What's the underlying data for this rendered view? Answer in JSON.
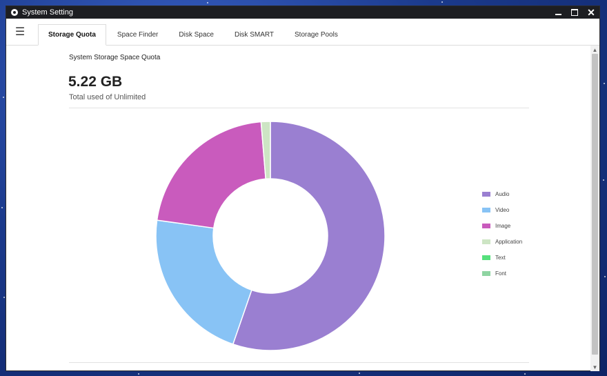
{
  "window": {
    "title": "System Setting"
  },
  "tabs": [
    {
      "label": "Storage Quota",
      "active": true
    },
    {
      "label": "Space Finder",
      "active": false
    },
    {
      "label": "Disk Space",
      "active": false
    },
    {
      "label": "Disk SMART",
      "active": false
    },
    {
      "label": "Storage Pools",
      "active": false
    }
  ],
  "quota": {
    "section_title": "System Storage Space Quota",
    "total_used": "5.22 GB",
    "subtitle": "Total used of Unlimited"
  },
  "chart_data": {
    "type": "pie",
    "donut": true,
    "labels": [
      "Audio",
      "Video",
      "Image",
      "Application",
      "Text",
      "Font"
    ],
    "values": [
      55.3,
      21.9,
      21.5,
      1.3,
      0,
      0
    ],
    "colors": [
      "#9a7fd1",
      "#88c3f5",
      "#c95bbd",
      "#cde5c4",
      "#56e07c",
      "#8fd4a2"
    ],
    "legend_position": "right"
  }
}
